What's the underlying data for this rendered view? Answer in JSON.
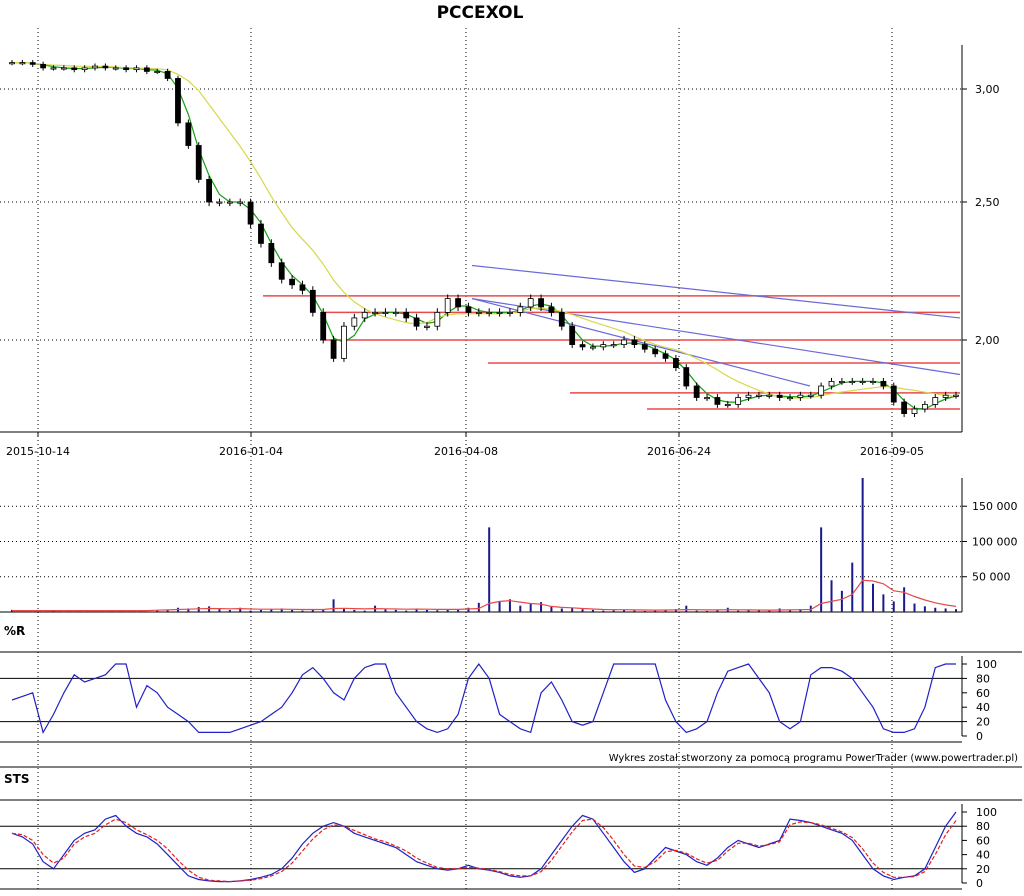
{
  "title": "PCCEXOL",
  "credit": "Wykres został stworzony za pomocą programu PowerTrader (www.powertrader.pl)",
  "colors": {
    "background": "#ffffff",
    "grid": "#000000",
    "candle": "#000000",
    "ma_short": "#14a014",
    "ma_long": "#d8d84a",
    "support_lines": "#e84a4a",
    "trend_lines": "#6a6ad8",
    "volume_bars": "#1a1a8c",
    "volume_avg": "#e84a4a",
    "williams_r": "#2020c8",
    "sts_k": "#2020c8",
    "sts_d": "#e02020",
    "level_lines": "#000000"
  },
  "chart_data": [
    {
      "type": "candlestick",
      "name": "price",
      "x_ticks": [
        "2015-10-14",
        "2016-01-04",
        "2016-04-08",
        "2016-06-24",
        "2016-09-05"
      ],
      "y_ticks": [
        "3,00",
        "2,50",
        "2,00"
      ],
      "ylim": [
        1.6,
        3.25
      ],
      "grid": "dotted",
      "close": [
        3.15,
        3.15,
        3.14,
        3.12,
        3.12,
        3.12,
        3.11,
        3.12,
        3.13,
        3.12,
        3.12,
        3.11,
        3.12,
        3.1,
        3.1,
        3.06,
        2.85,
        2.75,
        2.6,
        2.5,
        2.5,
        2.5,
        2.5,
        2.42,
        2.35,
        2.28,
        2.22,
        2.2,
        2.18,
        2.1,
        2.0,
        1.92,
        2.05,
        2.08,
        2.1,
        2.1,
        2.1,
        2.1,
        2.08,
        2.05,
        2.05,
        2.1,
        2.15,
        2.12,
        2.1,
        2.1,
        2.1,
        2.1,
        2.1,
        2.12,
        2.15,
        2.12,
        2.1,
        2.05,
        1.98,
        1.97,
        1.97,
        1.98,
        1.98,
        2.0,
        1.98,
        1.96,
        1.94,
        1.92,
        1.88,
        1.8,
        1.75,
        1.75,
        1.72,
        1.72,
        1.75,
        1.76,
        1.76,
        1.76,
        1.75,
        1.75,
        1.76,
        1.76,
        1.8,
        1.82,
        1.82,
        1.82,
        1.82,
        1.82,
        1.8,
        1.73,
        1.68,
        1.7,
        1.72,
        1.75,
        1.76,
        1.76
      ],
      "volume_ticks": [
        "150 000",
        "100 000",
        "50 000"
      ],
      "volume_ylim": [
        0,
        190000
      ],
      "volume": [
        3000,
        1000,
        800,
        600,
        1500,
        700,
        500,
        600,
        900,
        500,
        400,
        400,
        600,
        800,
        2000,
        3000,
        6000,
        5000,
        7000,
        8000,
        4000,
        3000,
        6000,
        2000,
        3000,
        4000,
        5000,
        3000,
        2000,
        3000,
        4000,
        18000,
        5000,
        3000,
        2000,
        9000,
        4000,
        3000,
        2000,
        5000,
        3000,
        2500,
        4000,
        3500,
        6000,
        13000,
        120000,
        15000,
        18000,
        9000,
        12000,
        14000,
        8000,
        5000,
        6000,
        4000,
        3000,
        2000,
        2500,
        3000,
        2000,
        1500,
        2000,
        3000,
        4000,
        9000,
        2000,
        1500,
        3000,
        6000,
        2000,
        3000,
        2500,
        2000,
        5000,
        3000,
        4000,
        9000,
        120000,
        45000,
        30000,
        70000,
        190000,
        40000,
        25000,
        15000,
        35000,
        12000,
        8000,
        6000,
        5000,
        4000
      ],
      "volume_avg": [
        2000,
        2000,
        2000,
        2000,
        2000,
        2000,
        2000,
        2000,
        2000,
        2000,
        2000,
        2000,
        2000,
        2000,
        2500,
        3000,
        3500,
        4000,
        4500,
        5000,
        4800,
        4500,
        4800,
        4200,
        4000,
        3900,
        4000,
        3800,
        3600,
        3500,
        3600,
        5000,
        5200,
        4800,
        4400,
        4800,
        4600,
        4300,
        4000,
        4100,
        3900,
        3700,
        3700,
        3700,
        4200,
        5000,
        12000,
        15000,
        16000,
        14000,
        12000,
        11000,
        8000,
        6500,
        6000,
        5000,
        4200,
        3500,
        3200,
        3200,
        3000,
        2800,
        2700,
        2800,
        3000,
        3400,
        3200,
        3000,
        3000,
        3200,
        3100,
        3000,
        2900,
        2700,
        2800,
        3000,
        3200,
        3600,
        12000,
        15000,
        18000,
        25000,
        45000,
        44000,
        40000,
        30000,
        28000,
        22000,
        17000,
        13000,
        10000,
        8000
      ]
    },
    {
      "type": "line",
      "name": "%R",
      "y_ticks": [
        "100",
        "80",
        "60",
        "40",
        "20",
        "0"
      ],
      "ylim": [
        0,
        100
      ],
      "levels": [
        20,
        80
      ],
      "values": [
        50,
        55,
        60,
        5,
        30,
        60,
        85,
        75,
        80,
        85,
        100,
        100,
        40,
        70,
        60,
        40,
        30,
        20,
        5,
        5,
        5,
        5,
        10,
        15,
        20,
        30,
        40,
        60,
        85,
        95,
        80,
        60,
        50,
        80,
        95,
        100,
        100,
        60,
        40,
        20,
        10,
        5,
        10,
        30,
        80,
        100,
        80,
        30,
        20,
        10,
        5,
        60,
        75,
        50,
        20,
        15,
        20,
        60,
        100,
        100,
        100,
        100,
        100,
        50,
        20,
        5,
        10,
        20,
        60,
        90,
        95,
        100,
        80,
        60,
        20,
        10,
        20,
        85,
        95,
        95,
        90,
        80,
        60,
        40,
        10,
        5,
        5,
        10,
        40,
        95,
        100,
        100
      ],
      "credit": "Wykres został stworzony za pomocą programu PowerTrader (www.powertrader.pl)"
    },
    {
      "type": "line",
      "name": "STS",
      "y_ticks": [
        "100",
        "80",
        "60",
        "40",
        "20",
        "0"
      ],
      "ylim": [
        0,
        100
      ],
      "levels": [
        20,
        80
      ],
      "series": [
        {
          "values": [
            70,
            65,
            55,
            30,
            20,
            40,
            60,
            70,
            75,
            90,
            95,
            80,
            70,
            65,
            55,
            40,
            25,
            10,
            5,
            3,
            2,
            2,
            3,
            5,
            8,
            12,
            20,
            35,
            55,
            70,
            80,
            85,
            80,
            70,
            65,
            60,
            55,
            50,
            40,
            30,
            25,
            20,
            18,
            20,
            25,
            20,
            18,
            15,
            10,
            8,
            10,
            20,
            40,
            60,
            80,
            95,
            90,
            70,
            50,
            30,
            15,
            20,
            35,
            50,
            45,
            40,
            30,
            25,
            35,
            50,
            60,
            55,
            50,
            55,
            60,
            90,
            88,
            85,
            80,
            75,
            70,
            60,
            40,
            20,
            10,
            5,
            8,
            10,
            20,
            50,
            80,
            100
          ]
        },
        {
          "values": [
            70,
            68,
            60,
            40,
            28,
            35,
            55,
            65,
            70,
            82,
            90,
            85,
            75,
            68,
            60,
            48,
            32,
            18,
            8,
            4,
            3,
            2,
            3,
            4,
            6,
            10,
            16,
            28,
            45,
            62,
            75,
            82,
            80,
            74,
            68,
            62,
            58,
            52,
            45,
            35,
            28,
            22,
            20,
            20,
            22,
            21,
            19,
            16,
            12,
            10,
            10,
            16,
            32,
            52,
            72,
            88,
            90,
            78,
            60,
            40,
            24,
            22,
            30,
            44,
            46,
            42,
            34,
            28,
            32,
            45,
            56,
            56,
            52,
            54,
            58,
            82,
            86,
            85,
            82,
            77,
            72,
            64,
            48,
            28,
            15,
            8,
            8,
            9,
            16,
            40,
            68,
            88
          ]
        }
      ]
    }
  ]
}
